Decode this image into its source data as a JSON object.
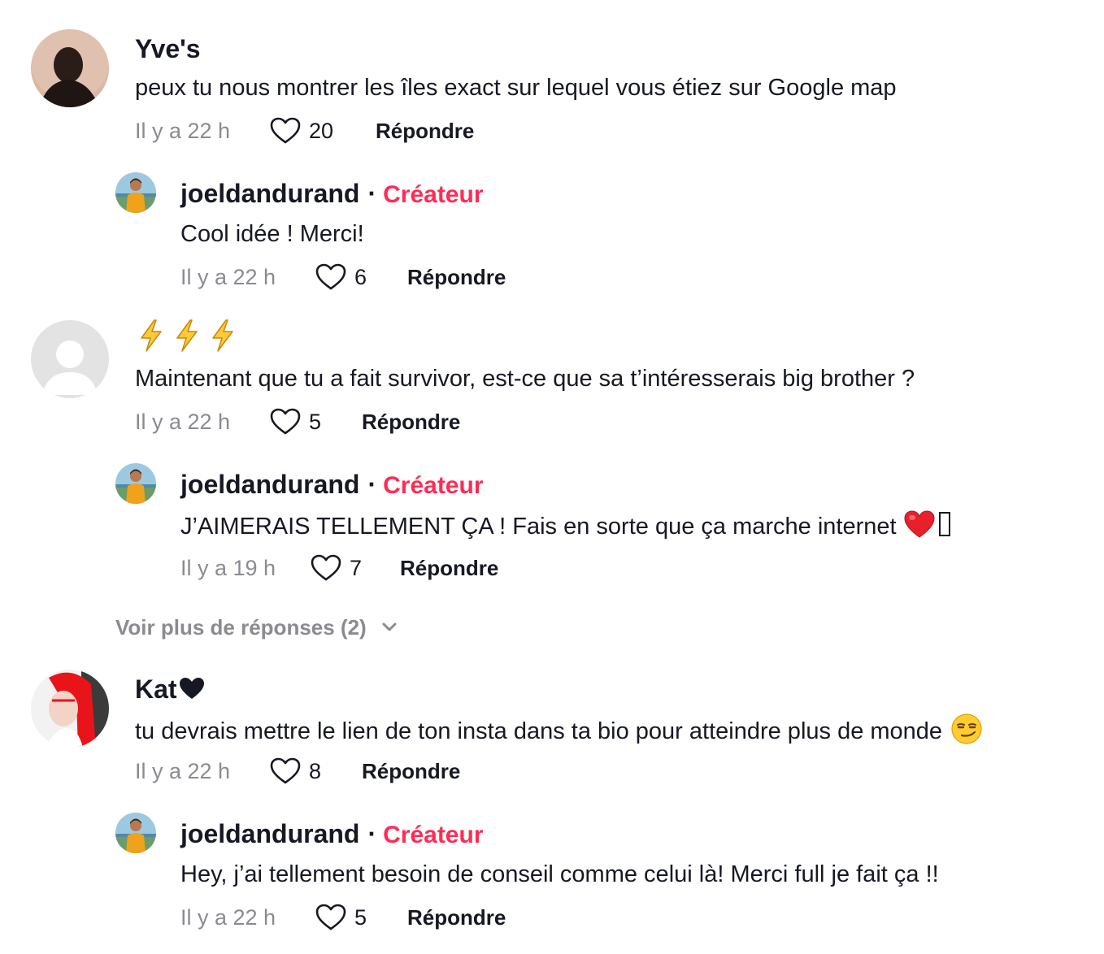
{
  "comments": [
    {
      "user": "Yve's",
      "text": "peux tu nous montrer les îles exact sur lequel vous étiez sur Google map",
      "time": "Il y a 22 h",
      "likes": "20",
      "reply_label": "Répondre",
      "reply": {
        "user": "joeldandurand",
        "badge": "Créateur",
        "text": "Cool idée ! Merci!",
        "time": "Il y a 22 h",
        "likes": "6",
        "reply_label": "Répondre"
      }
    },
    {
      "user": "",
      "user_icons": [
        "lightning-icon",
        "lightning-icon",
        "lightning-icon"
      ],
      "text": "Maintenant que tu a fait survivor, est-ce que sa t’intéresserais big brother ?",
      "time": "Il y a 22 h",
      "likes": "5",
      "reply_label": "Répondre",
      "reply": {
        "user": "joeldandurand",
        "badge": "Créateur",
        "text": "J’AIMERAIS TELLEMENT ÇA ! Fais en sorte que ça marche internet",
        "text_icons": [
          "red-heart-icon",
          "missing-glyph-icon"
        ],
        "time": "Il y a 19 h",
        "likes": "7",
        "reply_label": "Répondre"
      },
      "more_replies": "Voir plus de réponses (2)"
    },
    {
      "user": "Kat",
      "user_icons": [
        "black-heart-icon"
      ],
      "text": "tu devrais mettre le lien de ton insta dans ta bio pour atteindre plus de monde",
      "text_icons": [
        "smirk-emoji-icon"
      ],
      "time": "Il y a 22 h",
      "likes": "8",
      "reply_label": "Répondre",
      "reply": {
        "user": "joeldandurand",
        "badge": "Créateur",
        "text": "Hey, j’ai tellement besoin de conseil comme celui là! Merci full je fait ça !!",
        "time": "Il y a 22 h",
        "likes": "5",
        "reply_label": "Répondre"
      }
    }
  ],
  "colors": {
    "creator": "#fe2c55",
    "muted": "#8a8b91",
    "text": "#161823"
  }
}
